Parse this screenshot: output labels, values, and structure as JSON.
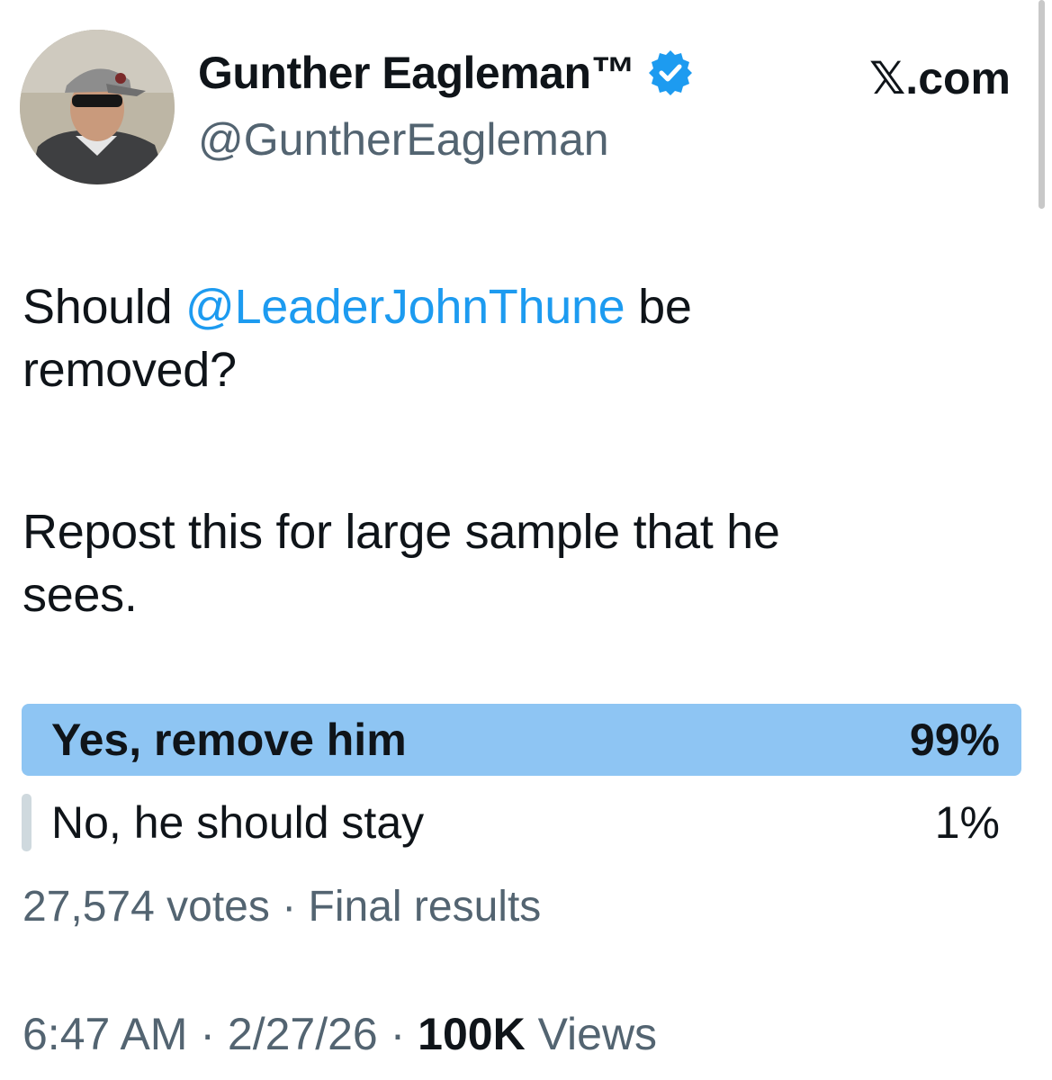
{
  "author": {
    "display_name": "Gunther Eagleman™",
    "handle": "@GuntherEagleman",
    "avatar_icon": "profile-photo",
    "verified_icon": "verified-badge-icon",
    "verified_color": "#1d9bf0"
  },
  "source": {
    "site": "𝕏.com"
  },
  "post": {
    "line1_prefix": "Should ",
    "mention": "@LeaderJohnThune",
    "line1_suffix": " be",
    "line2": "removed?",
    "line3": "Repost this for large sample that he",
    "line4": "sees."
  },
  "poll": {
    "options": [
      {
        "label": "Yes, remove him",
        "percent": "99%",
        "share": 1.0,
        "winner": true
      },
      {
        "label": "No, he should stay",
        "percent": "1%",
        "share": 0.01,
        "winner": false
      }
    ],
    "votes": "27,574 votes",
    "separator": " · ",
    "status": "Final results"
  },
  "meta": {
    "time": "6:47 AM",
    "separator": " · ",
    "date": "2/27/26",
    "views_count": "100K",
    "views_label": " Views"
  },
  "colors": {
    "accent": "#1d9bf0",
    "poll_winner_bar": "#8ec5f3",
    "poll_loser_bar": "#cfd9de",
    "secondary_text": "#536471"
  }
}
